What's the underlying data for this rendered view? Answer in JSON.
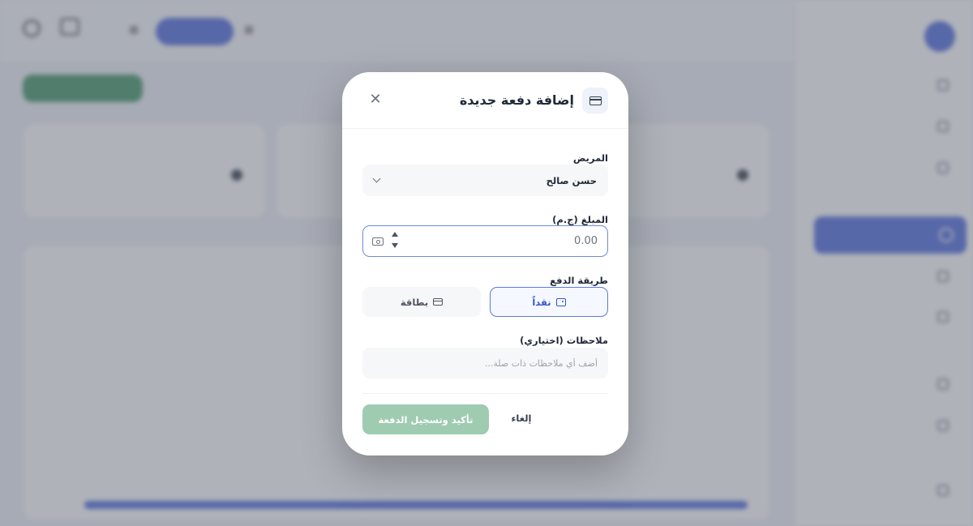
{
  "modal": {
    "title": "إضافة دفعة جديدة",
    "patient_label": "المريض",
    "patient_value": "حسن صالح",
    "amount_label": "المبلغ (ج.م)",
    "amount_value": "0.00",
    "payment_method_label": "طريقة الدفع",
    "payment_methods": [
      {
        "label": "نقداً",
        "selected": true
      },
      {
        "label": "بطاقة",
        "selected": false
      }
    ],
    "notes_label": "ملاحظات (اختياري)",
    "notes_placeholder": "أضف أي ملاحظات ذات صلة...",
    "confirm_label": "تأكيد وتسجيل الدفعة",
    "cancel_label": "إلغاء"
  },
  "colors": {
    "accent": "#3d5bd9",
    "confirm_button": "#9fcbb0",
    "overlay": "#6e7280"
  }
}
